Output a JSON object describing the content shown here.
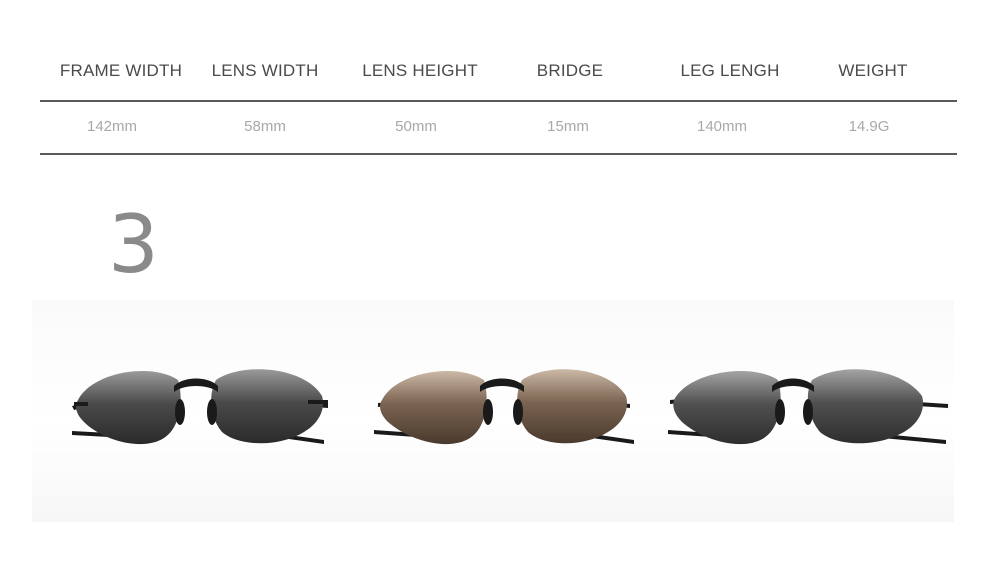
{
  "specs": {
    "headers": [
      "FRAME WIDTH",
      "LENS WIDTH",
      "LENS HEIGHT",
      "BRIDGE",
      "LEG LENGH",
      "WEIGHT"
    ],
    "values": [
      "142mm",
      "58mm",
      "50mm",
      "15mm",
      "140mm",
      "14.9G"
    ]
  },
  "variant_number": "3",
  "products": [
    {
      "name": "grey-lens-sunglasses",
      "lens_color": "#3a3a3a",
      "lens_highlight": "#9a9a9a"
    },
    {
      "name": "brown-lens-sunglasses",
      "lens_color": "#6a5442",
      "lens_highlight": "#c9b7a4"
    },
    {
      "name": "smoke-lens-sunglasses",
      "lens_color": "#3f3f3f",
      "lens_highlight": "#a2a2a2"
    }
  ],
  "colors": {
    "frame": "#1a1a1a",
    "header_text": "#4a4a4a",
    "value_text": "#a8a8a8",
    "number": "#8a8a8a"
  }
}
